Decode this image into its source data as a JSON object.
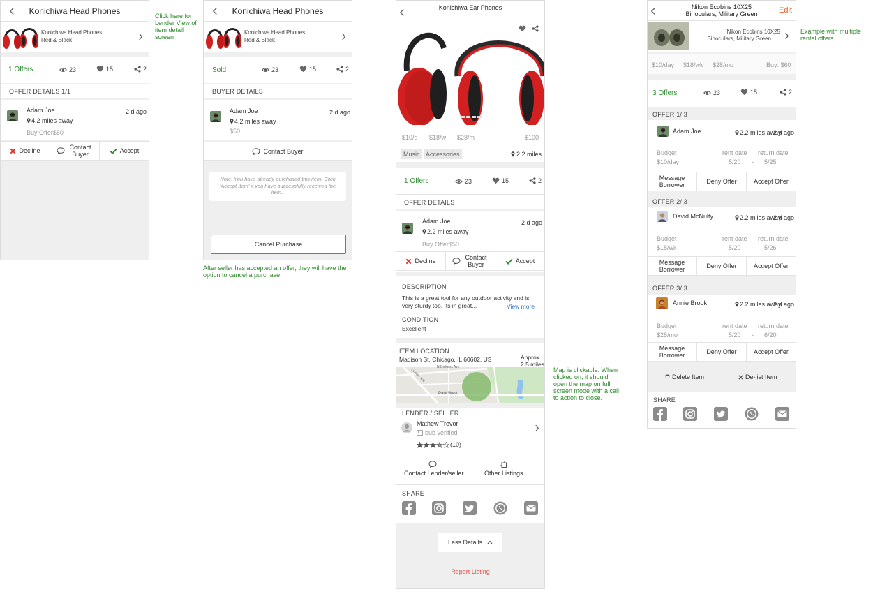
{
  "colors": {
    "green": "#2c8a2c",
    "red": "#d93a2b",
    "link": "#2f6fc4",
    "report": "#d9534f",
    "edit": "#e8632a"
  },
  "screen1": {
    "title": "Konichiwa Head Phones",
    "item_name": "Konichiwa Head Phones",
    "item_variant": "Red & Black",
    "offers": "1 Offers",
    "views": "23",
    "likes": "15",
    "shares": "2",
    "section": "OFFER  DETAILS 1/1",
    "buyer_name": "Adam Joe",
    "time": "2 d ago",
    "distance": "4.2 miles away",
    "offer_text": "Buy Offer$50",
    "decline": "Decline",
    "contact": "Contact Buyer",
    "accept": "Accept",
    "note": "Click here for Lender View of item detail screen"
  },
  "screen2": {
    "title": "Konichiwa Head Phones",
    "item_name": "Konichiwa Head Phones",
    "item_variant": "Red & Black",
    "status": "Sold",
    "views": "23",
    "likes": "15",
    "shares": "2",
    "section": "BUYER DETAILS",
    "buyer_name": "Adam Joe",
    "time": "2 d ago",
    "distance": "4.2 miles away",
    "price": "$50",
    "contact": "Contact Buyer",
    "purchase_note": "Note: You have already purchased this item. Click 'Accept Item' if you have successfully received the item..",
    "cancel": "Cancel Purchase",
    "note": "After seller has accepted an offer, they will have the option to cancel a purchase"
  },
  "screen3": {
    "title": "Konichiwa Ear Phones",
    "prices": [
      "$10/d",
      "$18/w",
      "$28/m",
      "$100"
    ],
    "tags": [
      "Music",
      "Accessories"
    ],
    "distance": "2.2 miles",
    "offers": "1 Offers",
    "views": "23",
    "likes": "15",
    "shares": "2",
    "section": "OFFER  DETAILS",
    "buyer_name": "Adam Joe",
    "time": "2 d ago",
    "buyer_distance": "2.2 miles away",
    "offer_text": "Buy Offer$50",
    "decline": "Decline",
    "contact": "Contact Buyer",
    "accept": "Accept",
    "desc_label": "DESCRIPTION",
    "desc_text": "This is a great tool for any outdoor activity and is very sturdy too. Its in great...",
    "view_more": "View more",
    "cond_label": "CONDITION",
    "cond_value": "Excellent",
    "loc_label": "ITEM LOCATION",
    "loc_value": "Madison St. Chicago, IL 60602, US",
    "approx": "Approx. 2.5 miles",
    "map_streets": [
      "N Dickens Ave",
      "Park West",
      "Lincoln Ave"
    ],
    "seller_label": "LENDER / SELLER",
    "seller_name": "Mathew Trevor",
    "seller_verified": "bub verified",
    "rating_count": "(10)",
    "rating": 3.5,
    "contact_seller": "Contact Lender/seller",
    "other_listings": "Other Listings",
    "share_label": "SHARE",
    "less_details": "Less Details",
    "report": "Report Listing",
    "note": "Map is clickable. When clicked on, it should open the map on full screen mode with a call to action to close."
  },
  "screen4": {
    "title_line1": "Nikon Ecobins 10X25",
    "title_line2": "Binoculars, Military Green",
    "edit": "Edit",
    "item_line1": "Nikon Ecobins 10X25",
    "item_line2": "Binoculars, Military Green",
    "prices": [
      "$10/day",
      "$18/wk",
      "$28/mo"
    ],
    "buy": "Buy: $60",
    "offers": "3 Offers",
    "views": "23",
    "likes": "15",
    "shares": "2",
    "labels": {
      "budget": "Budget",
      "rent": "rent date",
      "return": "return date",
      "message": "Message Borrower",
      "deny": "Deny Offer",
      "accept": "Accept Offer"
    },
    "offer_list": [
      {
        "header": "OFFER 1/ 3",
        "name": "Adam Joe",
        "distance": "2.2 miles away",
        "time": "2 d ago",
        "budget": "$10/day",
        "rent": "5/20",
        "ret": "5/25"
      },
      {
        "header": "OFFER 2/ 3",
        "name": "David McNulty",
        "distance": "2.2 miles away",
        "time": "2 d ago",
        "budget": "$18/wk",
        "rent": "5/20",
        "ret": "5/26"
      },
      {
        "header": "OFFER 3/ 3",
        "name": "Annie Brook",
        "distance": "2.2 miles away",
        "time": "2 d ago",
        "budget": "$28/mo",
        "rent": "5/20",
        "ret": "6/20"
      }
    ],
    "dash": "-",
    "delete": "Delete Item",
    "delist": "De-list Item",
    "share_label": "SHARE",
    "note": "Example with multiple rental offers"
  }
}
